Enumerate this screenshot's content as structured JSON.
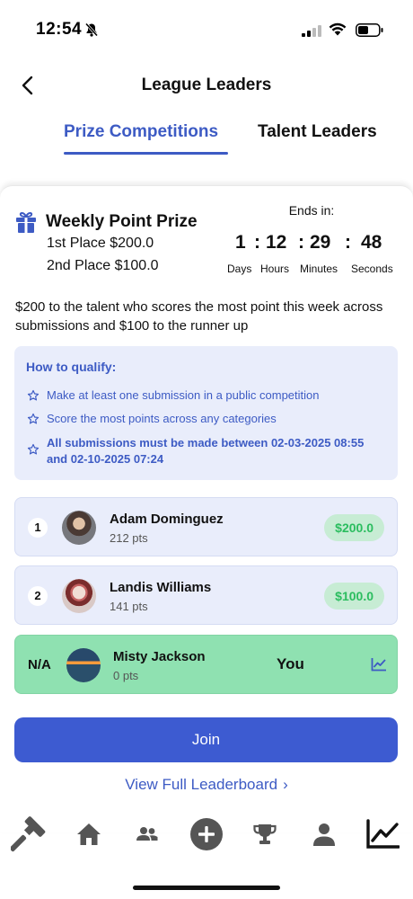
{
  "status_bar": {
    "time": "12:54"
  },
  "header": {
    "title": "League Leaders"
  },
  "tabs": [
    {
      "label": "Prize Competitions",
      "active": true
    },
    {
      "label": "Talent Leaders",
      "active": false
    }
  ],
  "prize": {
    "title": "Weekly Point Prize",
    "first_place": "1st Place $200.0",
    "second_place": "2nd Place $100.0",
    "description": "$200 to the talent who scores the most point this week across submissions and $100 to the runner up"
  },
  "countdown": {
    "label": "Ends in:",
    "days": "1",
    "hours": "12",
    "minutes": "29",
    "seconds": "48",
    "separator": ":",
    "days_label": "Days",
    "hours_label": "Hours",
    "minutes_label": "Minutes",
    "seconds_label": "Seconds"
  },
  "qualify": {
    "title": "How to qualify:",
    "items": [
      "Make at least one submission in a public competition",
      "Score the most points across any categories",
      "All submissions must be made between 02-03-2025 08:55 and 02-10-2025 07:24"
    ]
  },
  "leaderboard": [
    {
      "rank": "1",
      "name": "Adam Dominguez",
      "points": "212 pts",
      "prize": "$200.0"
    },
    {
      "rank": "2",
      "name": "Landis Williams",
      "points": "141 pts",
      "prize": "$100.0"
    }
  ],
  "you_row": {
    "rank": "N/A",
    "name": "Misty Jackson",
    "points": "0 pts",
    "you_label": "You"
  },
  "actions": {
    "join_label": "Join",
    "view_full_label": "View Full Leaderboard",
    "view_full_chevron": "›"
  },
  "bottom_nav": {
    "items": [
      "gavel-icon",
      "home-icon",
      "people-icon",
      "add-icon",
      "trophy-icon",
      "person-icon",
      "chart-icon"
    ]
  },
  "colors": {
    "accent": "#3d5bc4",
    "button": "#3d5bd1",
    "qualify_bg": "#e9edfb",
    "you_row_bg": "#8fe1b1",
    "prize_badge_text": "#2bbd5f"
  }
}
